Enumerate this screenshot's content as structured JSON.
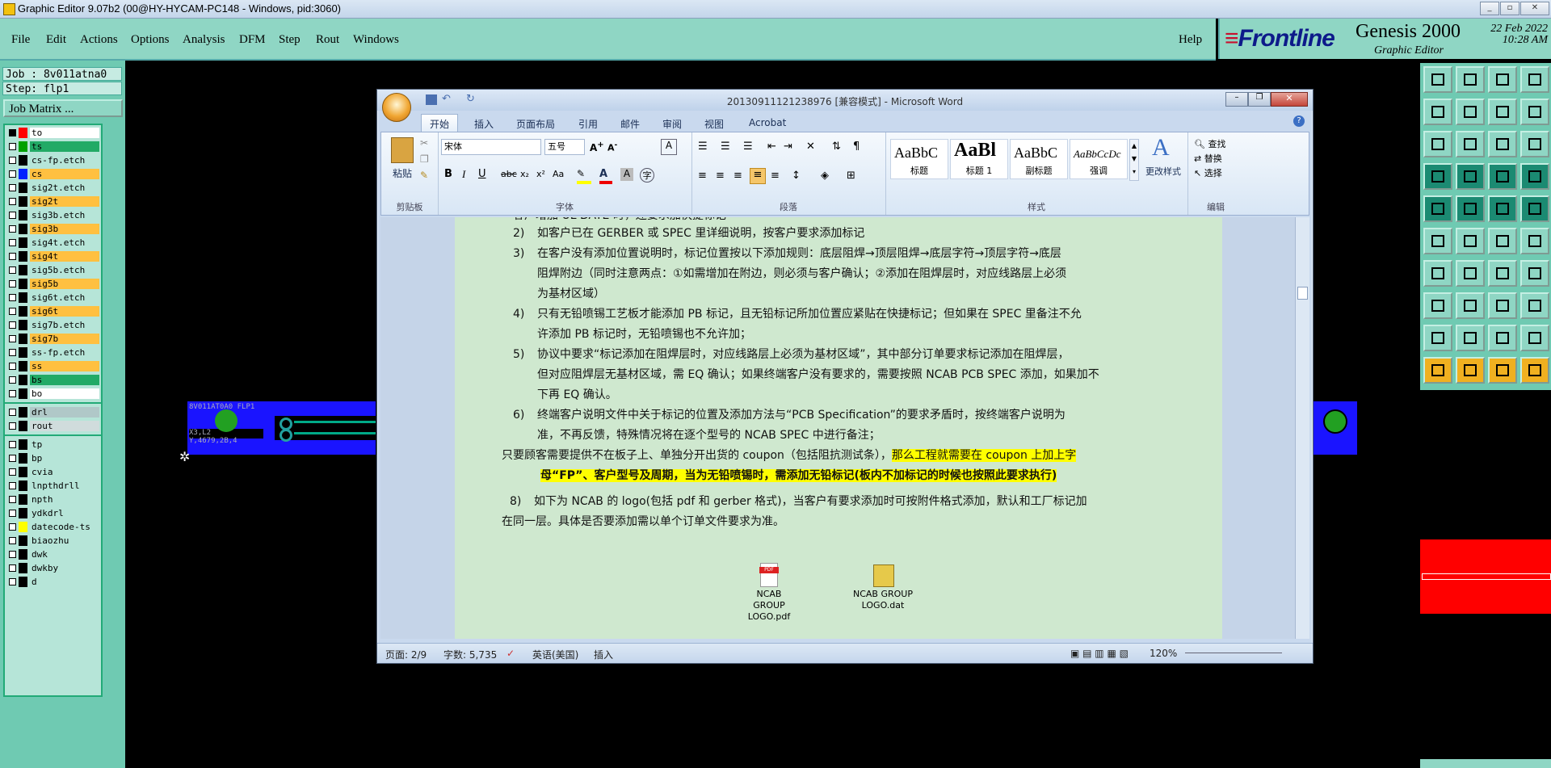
{
  "app": {
    "title": "Graphic Editor 9.07b2 (00@HY-HYCAM-PC148 - Windows, pid:3060)",
    "window_controls": [
      "_",
      "▫",
      "✕"
    ]
  },
  "menubar": {
    "items": [
      "File",
      "Edit",
      "Actions",
      "Options",
      "Analysis",
      "DFM",
      "Step",
      "Rout",
      "Windows"
    ],
    "help": "Help"
  },
  "brand": {
    "logo": "Frontline",
    "product": "Genesis 2000",
    "subtitle": "Graphic Editor",
    "date": "22 Feb 2022",
    "time": "10:28 AM"
  },
  "job": {
    "job_line": "Job : 8v011atna0",
    "step_line": "Step: flp1",
    "matrix_button": "Job Matrix ..."
  },
  "layers": [
    {
      "name": "to",
      "swatch": "#ff0000",
      "name_bg": "#ffffff",
      "checked": true
    },
    {
      "name": "ts",
      "swatch": "#00a000",
      "name_bg": "#22aa66"
    },
    {
      "name": "cs-fp.etch",
      "swatch": "#000000",
      "name_bg": "#b6e5d8"
    },
    {
      "name": "cs",
      "swatch": "#0022ff",
      "name_bg": "#ffc040"
    },
    {
      "name": "sig2t.etch",
      "swatch": "#000000",
      "name_bg": "#b6e5d8"
    },
    {
      "name": "sig2t",
      "swatch": "#000000",
      "name_bg": "#ffc040"
    },
    {
      "name": "sig3b.etch",
      "swatch": "#000000",
      "name_bg": "#b6e5d8"
    },
    {
      "name": "sig3b",
      "swatch": "#000000",
      "name_bg": "#ffc040"
    },
    {
      "name": "sig4t.etch",
      "swatch": "#000000",
      "name_bg": "#b6e5d8"
    },
    {
      "name": "sig4t",
      "swatch": "#000000",
      "name_bg": "#ffc040"
    },
    {
      "name": "sig5b.etch",
      "swatch": "#000000",
      "name_bg": "#b6e5d8"
    },
    {
      "name": "sig5b",
      "swatch": "#000000",
      "name_bg": "#ffc040"
    },
    {
      "name": "sig6t.etch",
      "swatch": "#000000",
      "name_bg": "#b6e5d8"
    },
    {
      "name": "sig6t",
      "swatch": "#000000",
      "name_bg": "#ffc040"
    },
    {
      "name": "sig7b.etch",
      "swatch": "#000000",
      "name_bg": "#b6e5d8"
    },
    {
      "name": "sig7b",
      "swatch": "#000000",
      "name_bg": "#ffc040"
    },
    {
      "name": "ss-fp.etch",
      "swatch": "#000000",
      "name_bg": "#b6e5d8"
    },
    {
      "name": "ss",
      "swatch": "#000000",
      "name_bg": "#ffc040"
    },
    {
      "name": "bs",
      "swatch": "#000000",
      "name_bg": "#22aa66"
    },
    {
      "name": "bo",
      "swatch": "#000000",
      "name_bg": "#ffffff"
    },
    {
      "name": "drl",
      "swatch": "#000000",
      "name_bg": "#b0c8c8"
    },
    {
      "name": "rout",
      "swatch": "#000000",
      "name_bg": "#d0dcdc"
    },
    {
      "name": "tp",
      "swatch": "#000000",
      "name_bg": "#b6e5d8"
    },
    {
      "name": "bp",
      "swatch": "#000000",
      "name_bg": "#b6e5d8"
    },
    {
      "name": "cvia",
      "swatch": "#000000",
      "name_bg": "#b6e5d8"
    },
    {
      "name": "lnpthdrll",
      "swatch": "#000000",
      "name_bg": "#b6e5d8"
    },
    {
      "name": "npth",
      "swatch": "#000000",
      "name_bg": "#b6e5d8"
    },
    {
      "name": "ydkdrl",
      "swatch": "#000000",
      "name_bg": "#b6e5d8"
    },
    {
      "name": "datecode-ts",
      "swatch": "#ffff00",
      "name_bg": "#b6e5d8"
    },
    {
      "name": "biaozhu",
      "swatch": "#000000",
      "name_bg": "#b6e5d8"
    },
    {
      "name": "dwk",
      "swatch": "#000000",
      "name_bg": "#b6e5d8"
    },
    {
      "name": "dwkby",
      "swatch": "#000000",
      "name_bg": "#b6e5d8"
    },
    {
      "name": "d",
      "swatch": "#000000",
      "name_bg": "#b6e5d8"
    }
  ],
  "board": {
    "label1": "8V011AT0A0 FLP1",
    "label2": "X3,L2 Y,4679,2B,4"
  },
  "word": {
    "title": "20130911121238976 [兼容模式] - Microsoft Word",
    "tabs": [
      "开始",
      "插入",
      "页面布局",
      "引用",
      "邮件",
      "审阅",
      "视图",
      "Acrobat"
    ],
    "clipboard": {
      "paste": "粘贴",
      "label": "剪贴板"
    },
    "font": {
      "name": "宋体",
      "size": "五号",
      "label": "字体"
    },
    "paragraph_label": "段落",
    "styles": {
      "tiles": [
        {
          "preview": "AaBbC",
          "name": "标题"
        },
        {
          "preview": "AaBl",
          "name": "标题 1"
        },
        {
          "preview": "AaBbC",
          "name": "副标题"
        },
        {
          "preview": "AaBbCcDc",
          "name": "强调"
        }
      ],
      "change": "更改样式",
      "label": "样式"
    },
    "editing": {
      "find": "查找",
      "replace": "替换",
      "select": "选择",
      "label": "编辑"
    },
    "doc": {
      "items": [
        {
          "num": "2)",
          "text": "如客户已在 GERBER 或 SPEC 里详细说明，按客户要求添加标记"
        },
        {
          "num": "3)",
          "lines": [
            "在客户没有添加位置说明时，标记位置按以下添加规则：底层阻焊→顶层阻焊→底层字符→顶层字符→底层",
            "阻焊附边（同时注意两点：①如需增加在附边，则必须与客户确认；②添加在阻焊层时，对应线路层上必须",
            "为基材区域）"
          ]
        },
        {
          "num": "4)",
          "lines": [
            "只有无铅喷锡工艺板才能添加 PB 标记，且无铅标记所加位置应紧贴在快捷标记；但如果在 SPEC 里备注不允",
            "许添加 PB 标记时，无铅喷锡也不允许加；"
          ]
        },
        {
          "num": "5)",
          "lines": [
            "协议中要求“标记添加在阻焊层时，对应线路层上必须为基材区域”，其中部分订单要求标记添加在阻焊层，",
            "但对应阻焊层无基材区域，需 EQ 确认；如果终端客户没有要求的，需要按照 NCAB PCB SPEC 添加，如果加不",
            "下再 EQ 确认。"
          ]
        },
        {
          "num": "6)",
          "lines": [
            "终端客户说明文件中关于标记的位置及添加方法与“PCB Specification”的要求矛盾时，按终端客户说明为",
            "准，不再反馈，特殊情况将在逐个型号的 NCAB SPEC 中进行备注；"
          ]
        }
      ],
      "coupon_line1_plain": "只要顾客需要提供不在板子上、单独分开出货的 coupon（包括阻抗测试条），",
      "coupon_line1_hl": "那么工程就需要在 coupon 上加上字",
      "coupon_line2_hl": "母“FP”、客户型号及周期，当为无铅喷锡时，需添加无铅标记(板内不加标记的时候也按照此要求执行)",
      "item8_num": "8)",
      "item8_line1": "如下为 NCAB 的 logo(包括 pdf 和 gerber 格式)，当客户有要求添加时可按附件格式添加，默认和工厂标记加",
      "item8_line2": "在同一层。具体是否要添加需以单个订单文件要求为准。",
      "top_partial": "客户增加 UL DATE 时，还要求加快捷标记",
      "attachments": [
        {
          "icon": "pdf-icon",
          "line1": "NCAB GROUP",
          "line2": "LOGO.pdf"
        },
        {
          "icon": "dat-icon",
          "line1": "NCAB GROUP",
          "line2": "LOGO.dat"
        }
      ]
    },
    "status": {
      "page": "页面: 2/9",
      "words": "字数: 5,735",
      "lang": "英语(美国)",
      "mode": "插入",
      "zoom": "120%"
    }
  },
  "colors": {
    "teal_panel": "#6fcab2",
    "teal_light": "#8fd6c4",
    "board_blue": "#1a14ff",
    "pad_green": "#22a022",
    "highlight": "#ffff00",
    "alert_red": "#ff0000"
  }
}
